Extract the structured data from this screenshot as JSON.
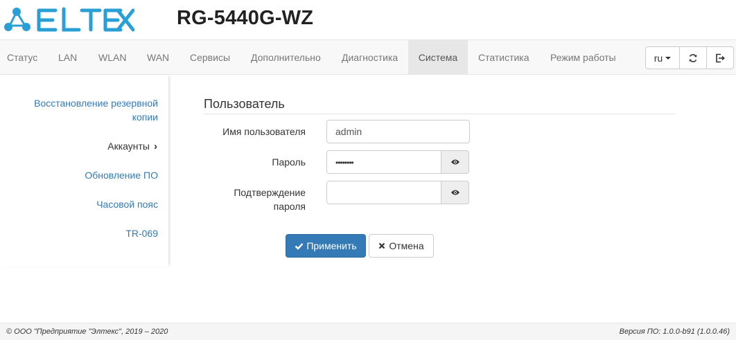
{
  "header": {
    "logo_text": "ELTEX",
    "model": "RG-5440G-WZ"
  },
  "nav": {
    "items": [
      {
        "label": "Статус"
      },
      {
        "label": "LAN"
      },
      {
        "label": "WLAN"
      },
      {
        "label": "WAN"
      },
      {
        "label": "Сервисы"
      },
      {
        "label": "Дополнительно"
      },
      {
        "label": "Диагностика"
      },
      {
        "label": "Система",
        "active": true
      },
      {
        "label": "Статистика"
      },
      {
        "label": "Режим работы"
      }
    ],
    "language": "ru"
  },
  "sidebar": {
    "items": [
      {
        "label_line1": "Восстановление резервной",
        "label_line2": "копии"
      },
      {
        "label": "Аккаунты",
        "active": true
      },
      {
        "label": "Обновление ПО"
      },
      {
        "label": "Часовой пояс"
      },
      {
        "label": "TR-069"
      }
    ]
  },
  "form": {
    "legend": "Пользователь",
    "username_label": "Имя пользователя",
    "username_value": "admin",
    "password_label": "Пароль",
    "password_value": "••••••••",
    "confirm_label_line1": "Подтверждение",
    "confirm_label_line2": "пароля",
    "confirm_value": "",
    "apply_label": "Применить",
    "cancel_label": "Отмена"
  },
  "footer": {
    "copyright": "© ООО \"Предприятие \"Элтекс\", 2019 – 2020",
    "version": "Версия ПО: 1.0.0-b91 (1.0.0.46)"
  },
  "colors": {
    "brand": "#2a9fd6",
    "link": "#337ab7",
    "primary_button": "#337ab7"
  },
  "icons": [
    "eltex-logo",
    "caret-down-icon",
    "refresh-icon",
    "logout-icon",
    "chevron-right-icon",
    "eye-icon",
    "check-icon",
    "close-icon"
  ]
}
